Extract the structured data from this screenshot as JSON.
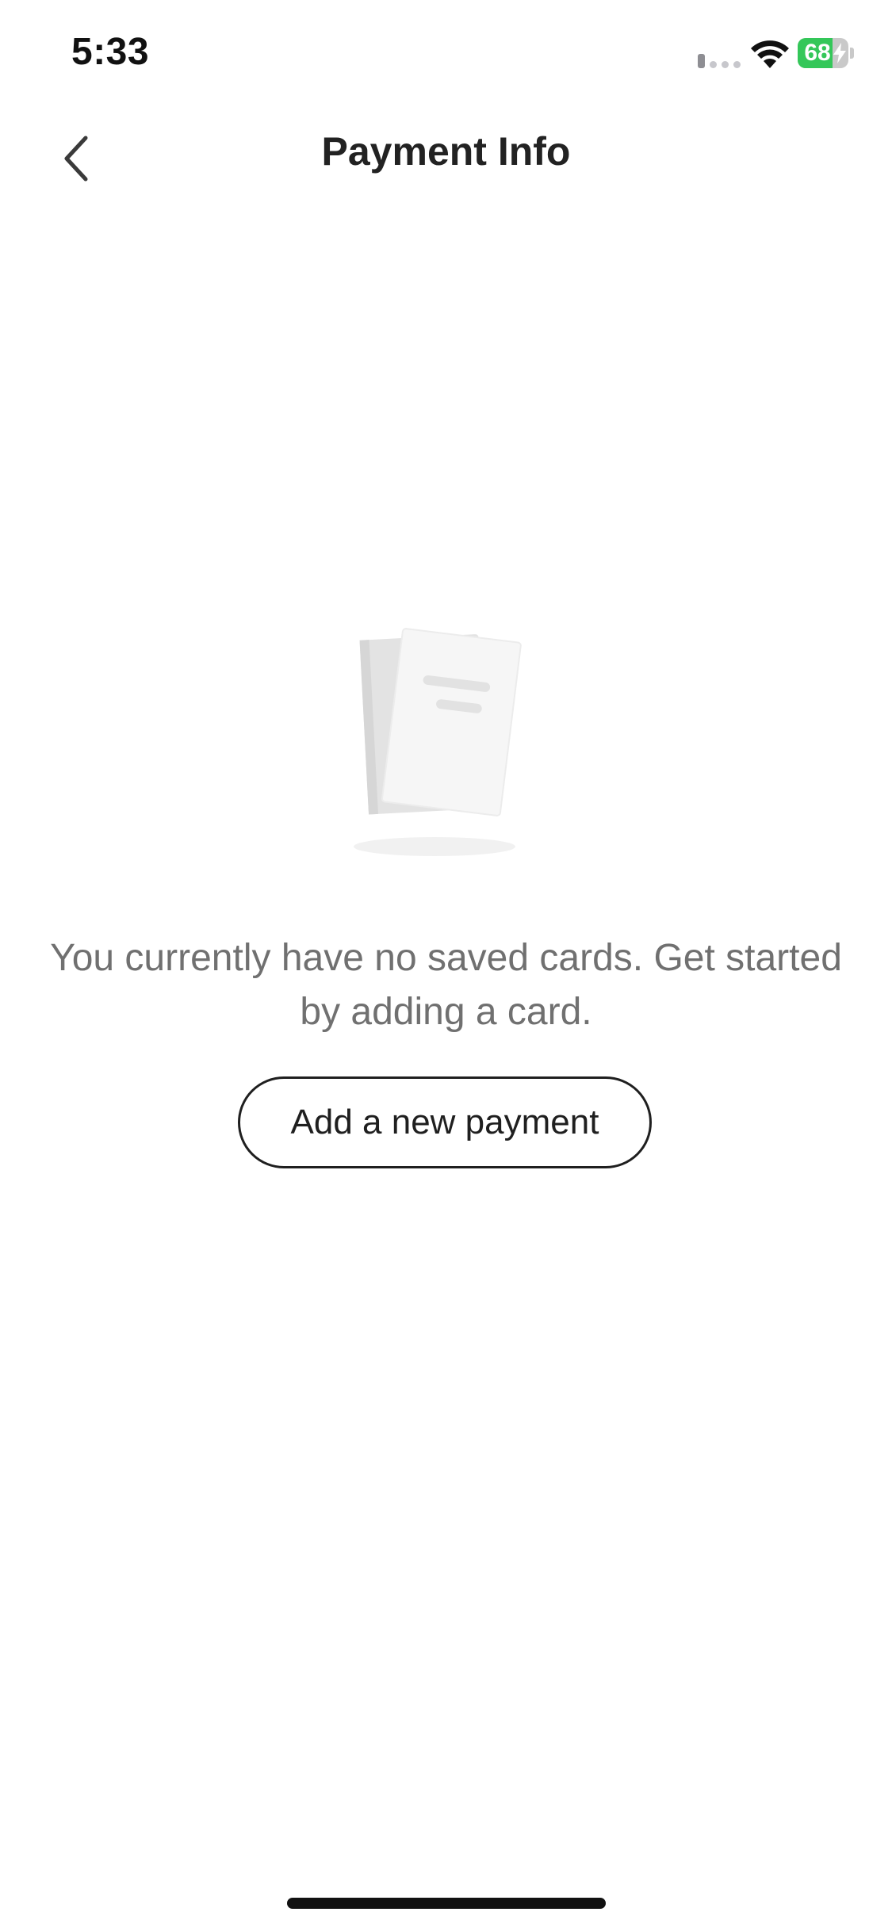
{
  "status_bar": {
    "time": "5:33",
    "battery_level": "68",
    "battery_fraction": 0.68,
    "battery_color": "#34c759",
    "icons": [
      "cellular-signal-icon",
      "wifi-icon",
      "battery-charging-icon"
    ]
  },
  "nav": {
    "back_icon": "chevron-left-icon",
    "title": "Payment Info"
  },
  "empty_state": {
    "illustration": "documents-icon",
    "message": "You currently have no saved cards. Get started by adding a card.",
    "button_label": "Add a new payment"
  }
}
